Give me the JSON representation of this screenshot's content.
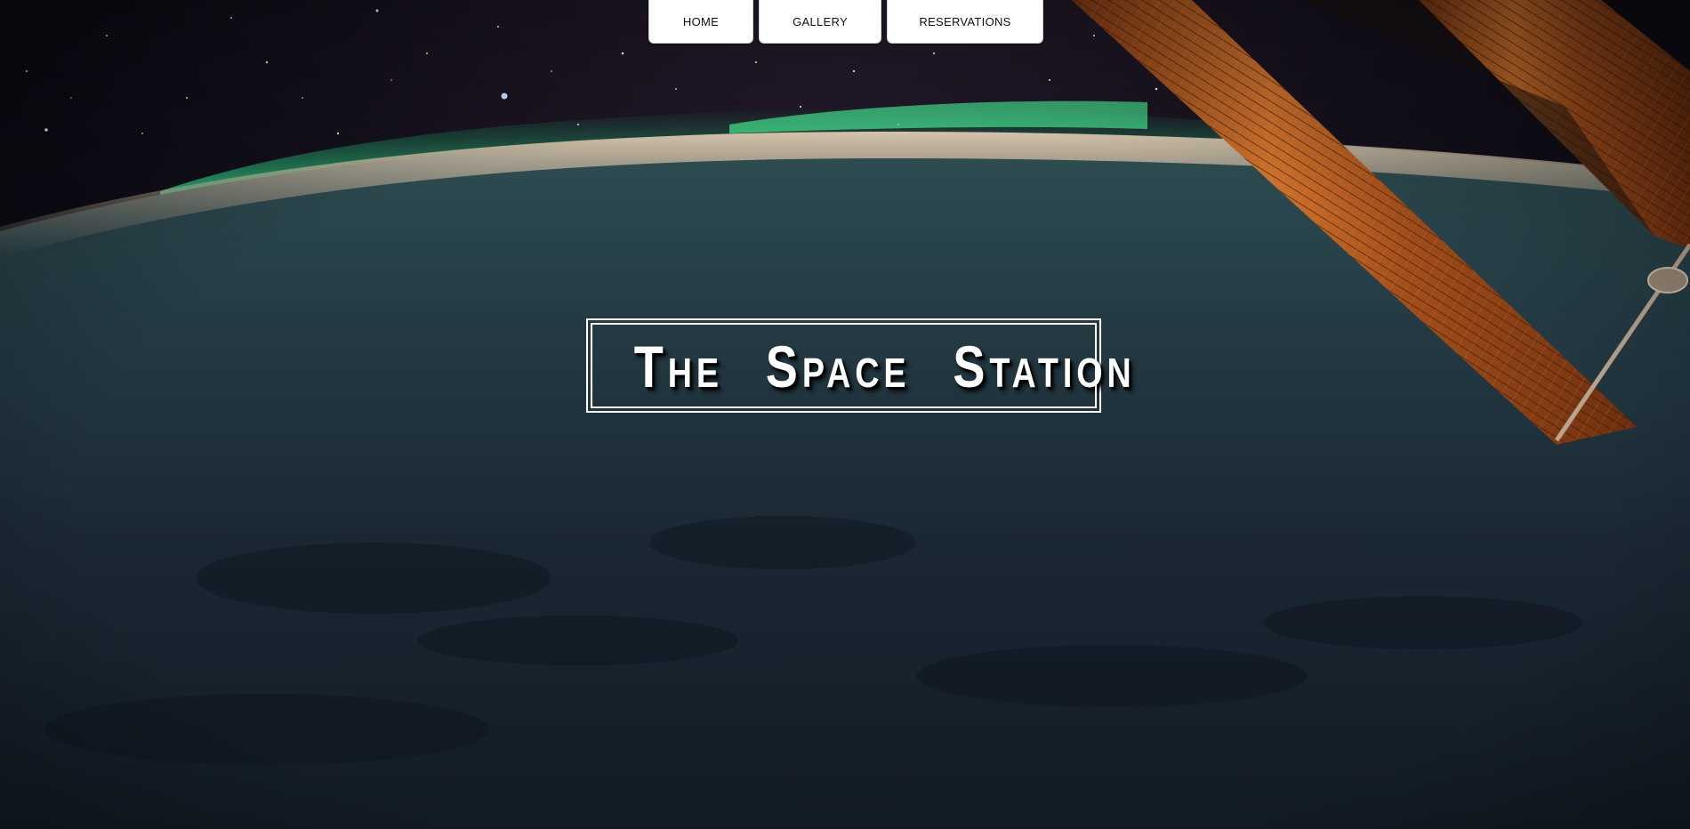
{
  "nav": {
    "items": [
      {
        "label": "HOME"
      },
      {
        "label": "GALLERY"
      },
      {
        "label": "RESERVATIONS"
      }
    ]
  },
  "hero": {
    "title": "The Space Station"
  },
  "colors": {
    "nav_bg": "#ffffff",
    "nav_text": "#111111",
    "title_text": "#ffffff",
    "aurora": "#2de08a",
    "solar_panel": "#c0611f",
    "earth_night": "#1a2a35"
  },
  "icons": {
    "background": "earth-from-orbit-image"
  }
}
